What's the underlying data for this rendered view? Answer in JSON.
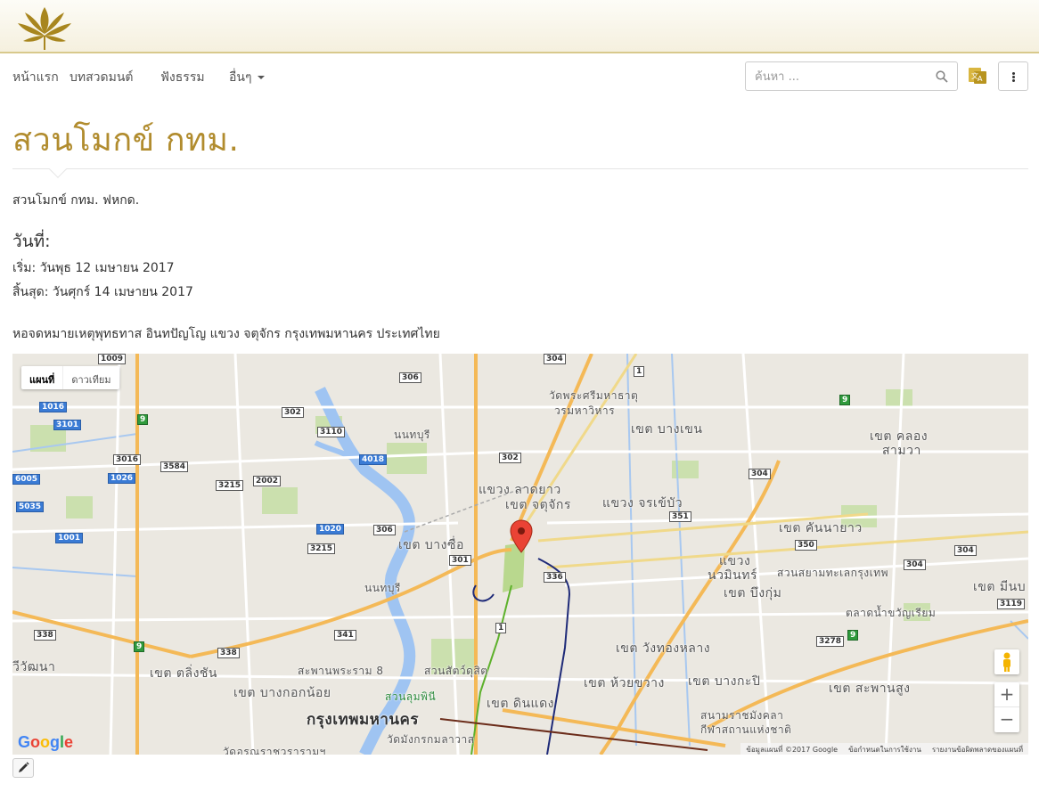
{
  "nav": {
    "items": [
      "หน้าแรก",
      "บทสวดมนต์",
      "ฟังธรรม",
      "อื่นๆ"
    ],
    "search_placeholder": "ค้นหา ..."
  },
  "page": {
    "title": "สวนโมกข์ กทม.",
    "intro": "สวนโมกข์ กทม. ฟหกด.",
    "date_heading": "วันที่:",
    "start": "เริ่ม: วันพุธ 12 เมษายน 2017",
    "end": "สิ้นสุด: วันศุกร์ 14 เมษายน 2017",
    "location": "หอจดหมายเหตุพุทธทาส อินทปัญโญ แขวง จตุจักร กรุงเทพมหานคร ประเทศไทย"
  },
  "map": {
    "type_map": "แผนที่",
    "type_satellite": "ดาวเทียม",
    "zoom_in": "+",
    "zoom_out": "−",
    "google": "Google",
    "attribution": [
      "ข้อมูลแผนที่ ©2017 Google",
      "ข้อกำหนดในการใช้งาน",
      "รายงานข้อผิดพลาดของแผนที่"
    ],
    "labels": {
      "wat_phra_sri": "วัดพระศรีมหาธาตุ",
      "worawihan": "วรมหาวิหาร",
      "bang_khen": "เขต บางเขน",
      "khlong_samwa_1": "เขต คลอง",
      "khlong_samwa_2": "สามวา",
      "lat_yao": "แขวง ลาดยาว",
      "chatuchak": "เขต จตุจักร",
      "chorakhe_bua": "แขวง จรเข้บัว",
      "nonthaburi": "นนทบุรี",
      "bang_sue": "เขต บางซื่อ",
      "khan_na_yao": "เขต คันนายาว",
      "nawamin_1": "แขวง",
      "nawamin_2": "นวมินทร์",
      "bueng_kum": "เขต บึงกุ่ม",
      "siam_park": "สวนสยามทะเลกรุงเทพ",
      "min_buri": "เขต มีนบ",
      "khwan_riam": "ตลาดน้ำขวัญเรียม",
      "wang_thonglang": "เขต วังทองหลาง",
      "taling_chan": "เขต ตลิ่งชัน",
      "wat_tana": "วีวัฒนา",
      "rama8": "สะพานพระราม 8",
      "zoo": "สวนสัตว์ดุสิต",
      "bangkok_noi": "เขต บางกอกน้อย",
      "lumphini": "สวนลุมพินี",
      "huai_khwang": "เขต ห้วยขวาง",
      "bang_kapi": "เขต บางกะปิ",
      "saphan_sung": "เขต สะพานสูง",
      "din_daeng": "เขต ดินแดง",
      "krung_thep": "กรุงเทพมหานคร",
      "rajamangala_1": "สนามราชมังคลา",
      "rajamangala_2": "กีฬาสถานแห่งชาติ",
      "wat_mangkon": "วัดมังกรกมลาวาส",
      "wat_arun": "วัดอรุณราชวรารามฯ",
      "nonthaburi2": "นนทบุรี"
    },
    "shields": [
      "1009",
      "1016",
      "3101",
      "3016",
      "6005",
      "1026",
      "5035",
      "1001",
      "3584",
      "3215",
      "2002",
      "302",
      "306",
      "3110",
      "4018",
      "1020",
      "306",
      "3215",
      "301",
      "302",
      "304",
      "1",
      "304",
      "351",
      "350",
      "304",
      "304",
      "336",
      "3119",
      "338",
      "338",
      "341",
      "3278",
      "1",
      "9",
      "9",
      "9",
      "9"
    ]
  },
  "colors": {
    "title": "#b18c2e",
    "topbar_border": "#d8c98c"
  }
}
